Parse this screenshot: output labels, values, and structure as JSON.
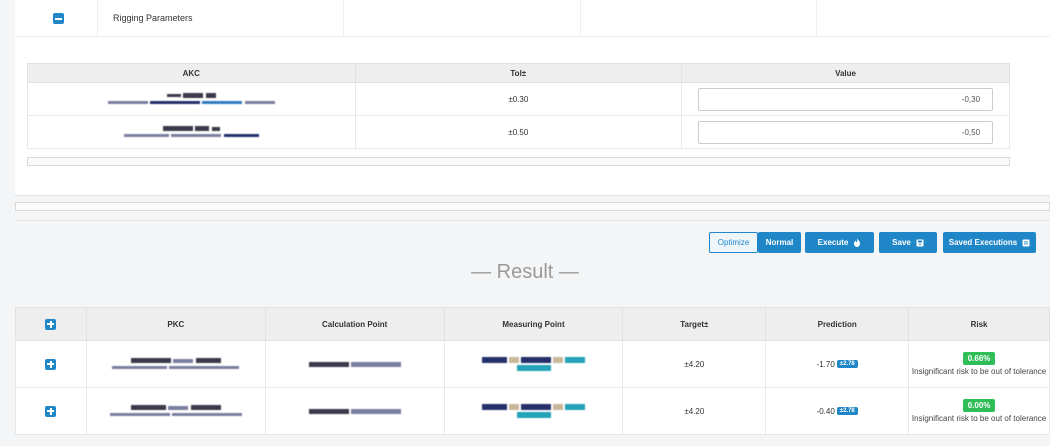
{
  "rigging": {
    "title": "Rigging Parameters"
  },
  "akc_table": {
    "headers": {
      "akc": "AKC",
      "tol": "Tol±",
      "value": "Value"
    },
    "rows": [
      {
        "tol": "±0.30",
        "value": "-0,30"
      },
      {
        "tol": "±0.50",
        "value": "-0,50"
      }
    ]
  },
  "toolbar": {
    "optimize": "Optimize",
    "normal": "Normal",
    "execute": "Execute",
    "save": "Save",
    "saved_executions": "Saved Executions"
  },
  "icons": {
    "execute": "fire-icon",
    "save": "lock-icon",
    "saved_executions": "archive-icon",
    "expand": "plus-square-icon",
    "collapse": "minus-square-icon"
  },
  "result": {
    "title": "— Result —"
  },
  "pkc_table": {
    "headers": {
      "pkc": "PKC",
      "calc_point": "Calculation Point",
      "measuring_point": "Measuring Point",
      "target": "Target±",
      "prediction": "Prediction",
      "risk": "Risk"
    },
    "rows": [
      {
        "target": "±4.20",
        "prediction": "-1.70",
        "prediction_badge": "±2.78",
        "risk_pct": "0.66%",
        "risk_text": "Insignificant risk to be out of tolerance"
      },
      {
        "target": "±4.20",
        "prediction": "-0.40",
        "prediction_badge": "±2.78",
        "risk_pct": "0.00%",
        "risk_text": "Insignificant risk to be out of tolerance"
      }
    ]
  },
  "colors": {
    "primary": "#1f87c7",
    "success": "#2ebd57",
    "header_bg": "#eeeeee",
    "page_bg": "#f4f5f7"
  }
}
